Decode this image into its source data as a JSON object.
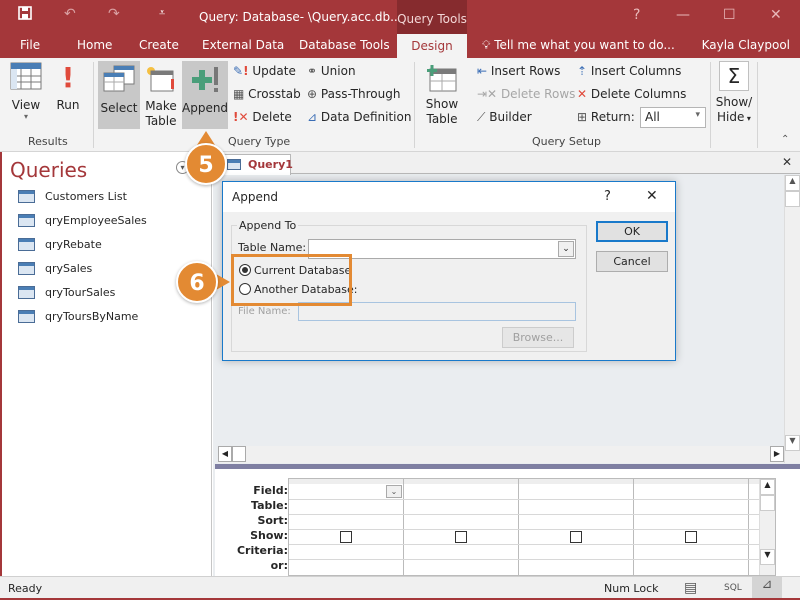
{
  "window": {
    "title": "Query: Database- \\Query.acc.db...",
    "context_tab_group": "Query Tools",
    "help": "?",
    "minimize": "—",
    "maximize": "☐",
    "close": "✕"
  },
  "quick_access": {
    "save": "save-icon",
    "undo": "↶",
    "redo": "↷",
    "customize": "⩡"
  },
  "tabs": [
    {
      "label": "File"
    },
    {
      "label": "Home"
    },
    {
      "label": "Create"
    },
    {
      "label": "External Data"
    },
    {
      "label": "Database Tools"
    },
    {
      "label": "Design",
      "active": true
    }
  ],
  "tell_me": "Tell me what you want to do...",
  "user": "Kayla Claypool",
  "ribbon": {
    "results": {
      "label": "Results",
      "view": "View",
      "run": "Run"
    },
    "query_type": {
      "label": "Query Type",
      "select": "Select",
      "make_table_1": "Make",
      "make_table_2": "Table",
      "append": "Append",
      "update": "Update",
      "crosstab": "Crosstab",
      "delete": "Delete",
      "union": "Union",
      "pass_through": "Pass-Through",
      "data_definition": "Data Definition"
    },
    "query_setup": {
      "label": "Query Setup",
      "show_table_1": "Show",
      "show_table_2": "Table",
      "insert_rows": "Insert Rows",
      "delete_rows": "Delete Rows",
      "builder": "Builder",
      "insert_columns": "Insert Columns",
      "delete_columns": "Delete Columns",
      "return_label": "Return:",
      "return_value": "All"
    },
    "show_hide": {
      "line1": "Show/",
      "line2": "Hide"
    }
  },
  "nav": {
    "title": "Queries",
    "items": [
      {
        "label": "Customers List"
      },
      {
        "label": "qryEmployeeSales"
      },
      {
        "label": "qryRebate"
      },
      {
        "label": "qrySales"
      },
      {
        "label": "qryTourSales"
      },
      {
        "label": "qryToursByName"
      }
    ]
  },
  "document_tab": {
    "label": "Query1",
    "close": "✕"
  },
  "dialog": {
    "title": "Append",
    "help": "?",
    "close": "✕",
    "group_label": "Append To",
    "table_name_label": "Table Name:",
    "table_name_value": "",
    "current_db": "Current Database",
    "another_db": "Another Database:",
    "selected": "Current Database",
    "file_name_label": "File Name:",
    "file_name_value": "",
    "browse": "Browse...",
    "ok": "OK",
    "cancel": "Cancel"
  },
  "grid": {
    "row_labels": [
      "Field:",
      "Table:",
      "Sort:",
      "Show:",
      "Criteria:",
      "or:"
    ]
  },
  "callouts": {
    "step5": "5",
    "step6": "6"
  },
  "status": {
    "text": "Ready",
    "num_lock": "Num Lock",
    "sql": "SQL"
  },
  "colors": {
    "accent": "#a4373a",
    "callout": "#e38a33",
    "dialog_border": "#1979ca"
  }
}
